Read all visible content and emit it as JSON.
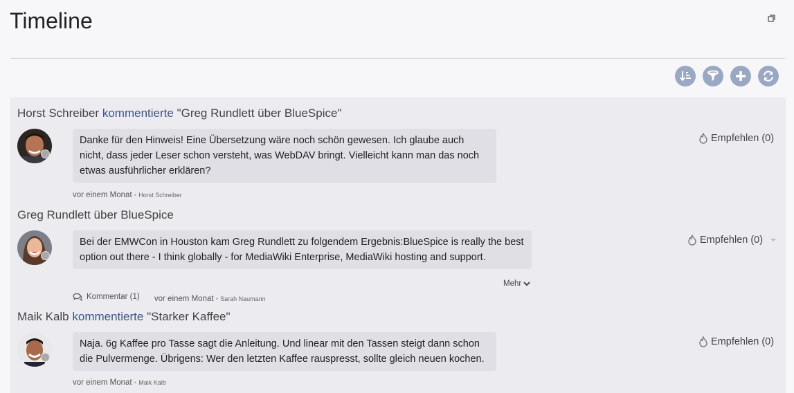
{
  "page": {
    "title": "Timeline"
  },
  "toolbar": {
    "buttons": [
      {
        "name": "sort-icon"
      },
      {
        "name": "filter-icon"
      },
      {
        "name": "add-icon"
      },
      {
        "name": "refresh-icon"
      }
    ]
  },
  "entries": [
    {
      "author": "Horst Schreiber",
      "action": "kommentierte",
      "target": "\"Greg Rundlett über BlueSpice\"",
      "text": "Danke für den Hinweis! Eine Übersetzung wäre noch schön gewesen. Ich glaube auch nicht, dass jeder Leser schon versteht, was WebDAV bringt. Vielleicht kann man das noch etwas ausführlicher erklären?",
      "time": "vor einem Monat",
      "sep": "•",
      "user": "Horst Schreiber",
      "recommend": "Empfehlen (0)"
    },
    {
      "title": "Greg Rundlett über BlueSpice",
      "text": "Bei der EMWCon in Houston kam Greg Rundlett zu folgendem Ergebnis:BlueSpice is really the best option out there - I think globally - for MediaWiki Enterprise, MediaWiki hosting and support.",
      "more": "Mehr",
      "comment": "Kommentar (1)",
      "time": "vor einem Monat",
      "sep": "•",
      "user": "Sarah Naumann",
      "recommend": "Empfehlen (0)"
    },
    {
      "author": "Maik Kalb",
      "action": "kommentierte",
      "target": "\"Starker Kaffee\"",
      "text": "Naja. 6g Kaffee pro Tasse sagt die Anleitung. Und linear mit den Tassen steigt dann schon die Pulvermenge. Übrigens: Wer den letzten Kaffee rauspresst, sollte gleich neuen kochen.",
      "time": "vor einem Monat",
      "sep": "•",
      "user": "Maik Kalb",
      "recommend": "Empfehlen (0)"
    }
  ],
  "colors": {
    "accent": "#3e5389",
    "toolbar_button": "#9aa8c4",
    "bubble": "#dfdfe5"
  }
}
